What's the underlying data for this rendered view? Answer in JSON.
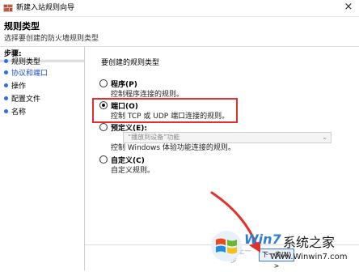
{
  "window": {
    "title": "新建入站规则向导",
    "close_icon": "×"
  },
  "header": {
    "title": "规则类型",
    "subtitle": "选择要创建的防火墙规则类型"
  },
  "steps": {
    "title": "步骤:",
    "items": [
      {
        "label": "规则类型"
      },
      {
        "label": "协议和端口"
      },
      {
        "label": "操作"
      },
      {
        "label": "配置文件"
      },
      {
        "label": "名称"
      }
    ]
  },
  "main": {
    "prompt": "要创建的规则类型",
    "options": [
      {
        "label": "程序(P)",
        "description": "控制程序连接的规则。",
        "checked": false
      },
      {
        "label": "端口(O)",
        "description": "控制 TCP 或 UDP 端口连接的规则。",
        "checked": true
      },
      {
        "label": "预定义(E):",
        "description": "控制 Windows 体验功能连接的规则。",
        "checked": false,
        "select_value": "“播放到设备”功能"
      },
      {
        "label": "自定义(C)",
        "description": "自定义规则。",
        "checked": false
      }
    ]
  },
  "buttons": {
    "back": "< 上一步",
    "next": "下一步(N) >"
  },
  "watermark": {
    "brand": "Win7",
    "name": "系统之家",
    "url": "Www.Winwin7.com"
  },
  "colors": {
    "highlight": "#e0312c",
    "link": "#1a4fc0",
    "step_dot": "#2d6ee0",
    "arrow": "#e0312c"
  }
}
